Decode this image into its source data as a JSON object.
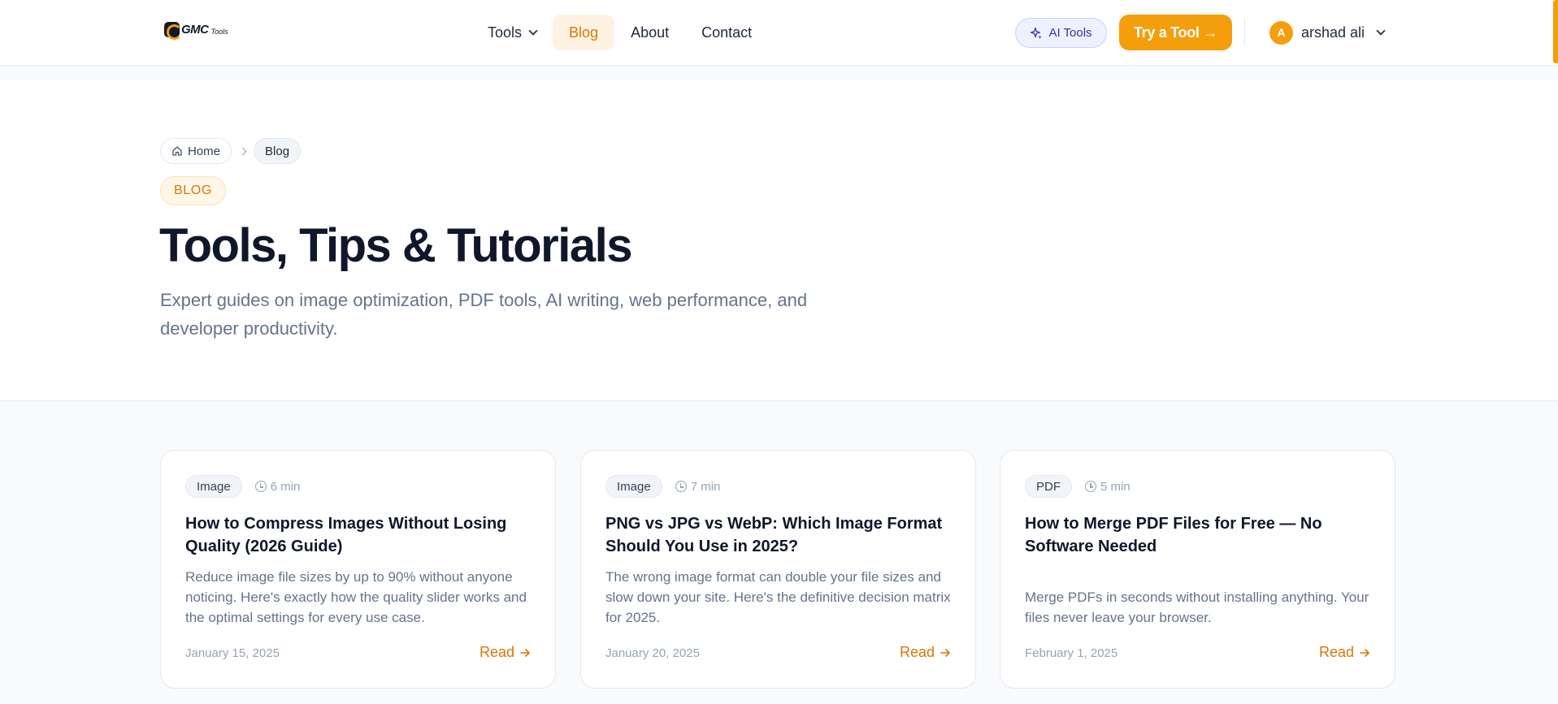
{
  "brand": {
    "logo_text": "GMC",
    "logo_sub": "Tools",
    "accent_color": "#f59e0b"
  },
  "nav": {
    "items": [
      {
        "label": "Tools",
        "has_dropdown": true,
        "active": false
      },
      {
        "label": "Blog",
        "active": true
      },
      {
        "label": "About",
        "active": false
      },
      {
        "label": "Contact",
        "active": false
      }
    ]
  },
  "header_actions": {
    "ai_tools_label": "AI Tools",
    "try_label": "Try a Tool →",
    "user": {
      "initial": "A",
      "name": "arshad ali"
    }
  },
  "breadcrumb": {
    "home_label": "Home",
    "current_label": "Blog"
  },
  "hero": {
    "badge": "BLOG",
    "title": "Tools, Tips & Tutorials",
    "subtitle": "Expert guides on image optimization, PDF tools, AI writing, web performance, and developer productivity."
  },
  "cards": [
    {
      "tag": "Image",
      "read_time": "6 min",
      "title": "How to Compress Images Without Losing Quality (2026 Guide)",
      "description": "Reduce image file sizes by up to 90% without anyone noticing. Here's exactly how the quality slider works and the optimal settings for every use case.",
      "date": "January 15, 2025",
      "read_label": "Read"
    },
    {
      "tag": "Image",
      "read_time": "7 min",
      "title": "PNG vs JPG vs WebP: Which Image Format Should You Use in 2025?",
      "description": "The wrong image format can double your file sizes and slow down your site. Here's the definitive decision matrix for 2025.",
      "date": "January 20, 2025",
      "read_label": "Read"
    },
    {
      "tag": "PDF",
      "read_time": "5 min",
      "title": "How to Merge PDF Files for Free — No Software Needed",
      "description": "Merge PDFs in seconds without installing anything. Your files never leave your browser.",
      "date": "February 1, 2025",
      "read_label": "Read"
    }
  ]
}
